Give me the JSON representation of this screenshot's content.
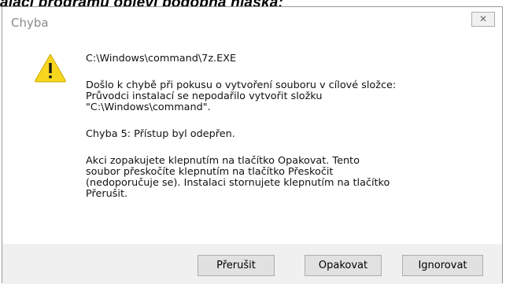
{
  "page_caption": "alaci programu objeví podobná hláška:",
  "dialog": {
    "title": "Chyba",
    "close_glyph": "✕",
    "icon": "warning-icon",
    "message": {
      "path": "C:\\Windows\\command\\7z.EXE",
      "error_line1": "Došlo k chybě při pokusu o vytvoření souboru v cílové složce:",
      "error_line2": "Průvodci instalací se nepodařilo vytvořit složku",
      "error_line3": "\"C:\\Windows\\command\".",
      "code_line": "Chyba 5: Přístup byl odepřen.",
      "help_line1": "Akci zopakujete klepnutím na tlačítko Opakovat. Tento",
      "help_line2": "soubor přeskočíte klepnutím na tlačítko Přeskočit",
      "help_line3": "(nedoporučuje se). Instalaci stornujete klepnutím na tlačítko",
      "help_line4": "Přerušit."
    },
    "buttons": {
      "abort": "Přerušit",
      "retry": "Opakovat",
      "ignore": "Ignorovat"
    },
    "colors": {
      "warning_fill": "#f7d61e",
      "footer_bg": "#f0f0f0",
      "button_bg": "#e1e1e1"
    }
  }
}
